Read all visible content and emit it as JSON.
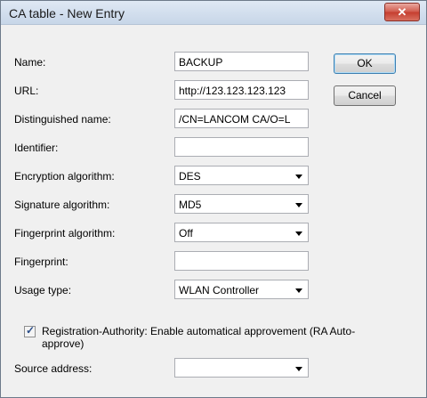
{
  "window": {
    "title": "CA table - New Entry",
    "close_glyph": "✕"
  },
  "buttons": {
    "ok": "OK",
    "cancel": "Cancel"
  },
  "fields": {
    "name": {
      "label": "Name:",
      "value": "BACKUP"
    },
    "url": {
      "label": "URL:",
      "value": "http://123.123.123.123"
    },
    "dn": {
      "label": "Distinguished name:",
      "value": "/CN=LANCOM CA/O=L"
    },
    "identifier": {
      "label": "Identifier:",
      "value": ""
    },
    "encryption": {
      "label": "Encryption algorithm:",
      "value": "DES"
    },
    "signature": {
      "label": "Signature algorithm:",
      "value": "MD5"
    },
    "fp_algorithm": {
      "label": "Fingerprint algorithm:",
      "value": "Off"
    },
    "fingerprint": {
      "label": "Fingerprint:",
      "value": ""
    },
    "usage": {
      "label": "Usage type:",
      "value": "WLAN Controller"
    },
    "source": {
      "label": "Source address:",
      "value": ""
    }
  },
  "registration": {
    "checked": true,
    "check_glyph": "✓",
    "label": "Registration-Authority: Enable automatical approvement (RA Auto-approve)"
  }
}
